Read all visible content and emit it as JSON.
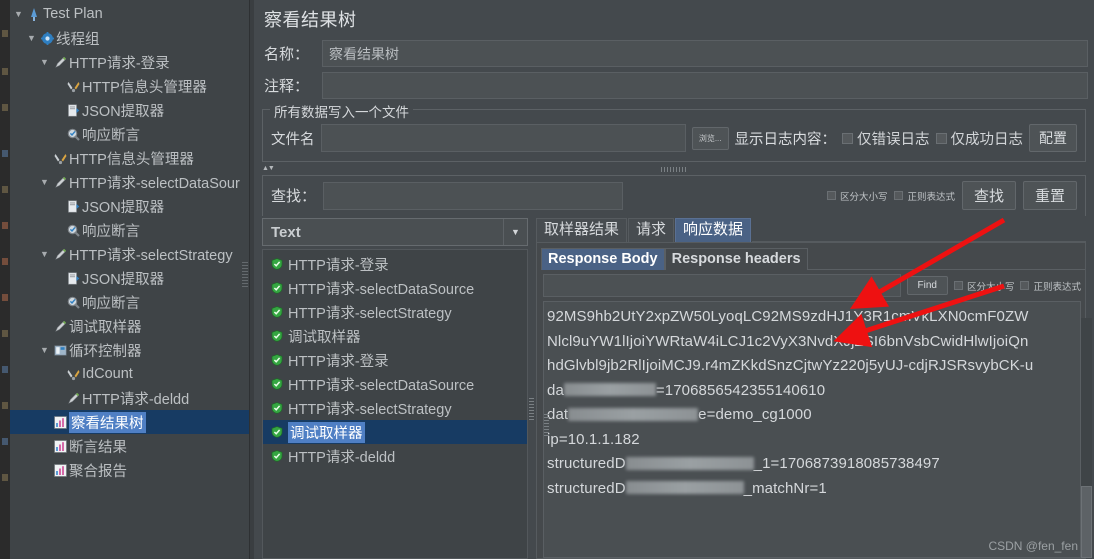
{
  "tree": {
    "items": [
      {
        "label": "Test Plan",
        "indent": 0,
        "twisty": "down",
        "icon": "testplan-icon",
        "selected": false
      },
      {
        "label": "线程组",
        "indent": 1,
        "twisty": "down",
        "icon": "threadgroup-gear-icon",
        "selected": false
      },
      {
        "label": "HTTP请求-登录",
        "indent": 2,
        "twisty": "down",
        "icon": "http-sampler-icon",
        "selected": false
      },
      {
        "label": "HTTP信息头管理器",
        "indent": 3,
        "twisty": "none",
        "icon": "header-manager-icon",
        "selected": false
      },
      {
        "label": "JSON提取器",
        "indent": 3,
        "twisty": "none",
        "icon": "json-extractor-icon",
        "selected": false
      },
      {
        "label": "响应断言",
        "indent": 3,
        "twisty": "none",
        "icon": "assertion-icon",
        "selected": false
      },
      {
        "label": "HTTP信息头管理器",
        "indent": 2,
        "twisty": "none",
        "icon": "header-manager-icon",
        "selected": false
      },
      {
        "label": "HTTP请求-selectDataSour",
        "indent": 2,
        "twisty": "down",
        "icon": "http-sampler-icon",
        "selected": false
      },
      {
        "label": "JSON提取器",
        "indent": 3,
        "twisty": "none",
        "icon": "json-extractor-icon",
        "selected": false
      },
      {
        "label": "响应断言",
        "indent": 3,
        "twisty": "none",
        "icon": "assertion-icon",
        "selected": false
      },
      {
        "label": "HTTP请求-selectStrategy",
        "indent": 2,
        "twisty": "down",
        "icon": "http-sampler-icon",
        "selected": false
      },
      {
        "label": "JSON提取器",
        "indent": 3,
        "twisty": "none",
        "icon": "json-extractor-icon",
        "selected": false
      },
      {
        "label": "响应断言",
        "indent": 3,
        "twisty": "none",
        "icon": "assertion-icon",
        "selected": false
      },
      {
        "label": "调试取样器",
        "indent": 2,
        "twisty": "none",
        "icon": "debug-sampler-icon",
        "selected": false
      },
      {
        "label": "循环控制器",
        "indent": 2,
        "twisty": "down",
        "icon": "loop-controller-icon",
        "selected": false
      },
      {
        "label": "IdCount",
        "indent": 3,
        "twisty": "none",
        "icon": "counter-icon",
        "selected": false
      },
      {
        "label": "HTTP请求-deldd",
        "indent": 3,
        "twisty": "none",
        "icon": "http-sampler-icon",
        "selected": false
      },
      {
        "label": "察看结果树",
        "indent": 2,
        "twisty": "none",
        "icon": "view-results-tree-icon",
        "selected": true
      },
      {
        "label": "断言结果",
        "indent": 2,
        "twisty": "none",
        "icon": "assertion-results-icon",
        "selected": false
      },
      {
        "label": "聚合报告",
        "indent": 2,
        "twisty": "none",
        "icon": "aggregate-report-icon",
        "selected": false
      }
    ]
  },
  "main": {
    "title": "察看结果树",
    "name_label": "名称：",
    "name_value": "察看结果树",
    "comment_label": "注释：",
    "comment_value": "",
    "filegroup": {
      "title": "所有数据写入一个文件",
      "filename_label": "文件名",
      "filename_value": "",
      "browse_label": "浏览...",
      "log_caption": "显示日志内容：",
      "errors_only_label": "仅错误日志",
      "success_only_label": "仅成功日志",
      "configure_label": "配置"
    },
    "search": {
      "label": "查找：",
      "value": "",
      "case_sensitive_label": "区分大小写",
      "regex_label": "正则表达式",
      "find_label": "查找",
      "reset_label": "重置"
    }
  },
  "results": {
    "renderer_selected": "Text",
    "items": [
      {
        "label": "HTTP请求-登录",
        "status": "ok",
        "selected": false
      },
      {
        "label": "HTTP请求-selectDataSource",
        "status": "ok",
        "selected": false
      },
      {
        "label": "HTTP请求-selectStrategy",
        "status": "ok",
        "selected": false
      },
      {
        "label": "调试取样器",
        "status": "ok",
        "selected": false
      },
      {
        "label": "HTTP请求-登录",
        "status": "ok",
        "selected": false
      },
      {
        "label": "HTTP请求-selectDataSource",
        "status": "ok",
        "selected": false
      },
      {
        "label": "HTTP请求-selectStrategy",
        "status": "ok",
        "selected": false
      },
      {
        "label": "调试取样器",
        "status": "ok",
        "selected": true
      },
      {
        "label": "HTTP请求-deldd",
        "status": "ok",
        "selected": false
      }
    ]
  },
  "detail": {
    "tabs": [
      {
        "label": "取样器结果",
        "active": false
      },
      {
        "label": "请求",
        "active": false
      },
      {
        "label": "响应数据",
        "active": true
      }
    ],
    "subtabs": [
      {
        "label": "Response Body",
        "active": true
      },
      {
        "label": "Response headers",
        "active": false
      }
    ],
    "find": {
      "value": "",
      "find_label": "Find",
      "case_sensitive_label": "区分大小写",
      "regex_label": "正则表达式"
    },
    "body_lines": [
      {
        "text": "92MS9hb2UtY2xpZW50LyoqLC92MS9zdHJ1Y3R1cmVkLXN0cmF0ZW",
        "redact": null
      },
      {
        "text": "Nlcl9uYW1lIjoiYWRtaW4iLCJ1c2VyX3NvdXJjZSI6bnVsbCwidHlwIjoiQn",
        "redact": null
      },
      {
        "text": "hdGlvbl9jb2RlIjoiMCJ9.r4mZKkdSnzCjtwYz220j5yUJ-cdjRJSRsvybCK-u",
        "redact": null
      },
      {
        "pre": "da",
        "redact": 92,
        "post": "=1706856542355140610"
      },
      {
        "pre": "dat",
        "redact": 130,
        "post": "e=demo_cg1000"
      },
      {
        "text": "ip=10.1.1.182",
        "redact": null
      },
      {
        "pre": "structuredD",
        "redact": 128,
        "post": "_1=1706873918085738497"
      },
      {
        "pre": "structuredD",
        "redact": 118,
        "post": "_matchNr=1"
      }
    ]
  },
  "watermark": "CSDN @fen_fen"
}
